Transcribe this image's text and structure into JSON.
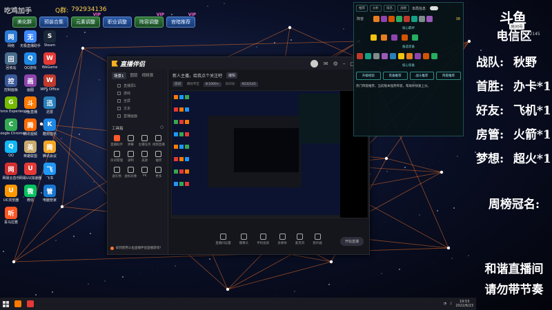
{
  "banner": {
    "logo": "吃鸡加手",
    "qq_label": "Q群:",
    "qq_number": "792934136"
  },
  "groups": [
    {
      "label": "美化群",
      "vip": ""
    },
    {
      "label": "预装合集",
      "vip": ""
    },
    {
      "label": "元素调整",
      "vip": "VIP"
    },
    {
      "label": "职业调整",
      "vip": ""
    },
    {
      "label": "阵容调整",
      "vip": "VIP"
    },
    {
      "label": "官暗推荐",
      "vip": "VIP"
    }
  ],
  "desktop_icons": [
    {
      "label": "网络",
      "color": "#2b7bd6",
      "glyph": "网"
    },
    {
      "label": "无极直播助手",
      "color": "#3d89ff",
      "glyph": "无"
    },
    {
      "label": "Steam",
      "color": "#1b2838",
      "glyph": "S"
    },
    {
      "label": "回收站",
      "color": "#4a6c8c",
      "glyph": "回"
    },
    {
      "label": "QQ游戏",
      "color": "#1e88e5",
      "glyph": "Q"
    },
    {
      "label": "WeGame",
      "color": "#e53935",
      "glyph": "W"
    },
    {
      "label": "控制面板",
      "color": "#3b5998",
      "glyph": "控"
    },
    {
      "label": "画图",
      "color": "#8e44ad",
      "glyph": "画"
    },
    {
      "label": "WPS Office",
      "color": "#c0392b",
      "glyph": "W"
    },
    {
      "label": "GeForce Experience",
      "color": "#76b900",
      "glyph": "G"
    },
    {
      "label": "斗鱼直播",
      "color": "#ff7a00",
      "glyph": "斗"
    },
    {
      "label": "迅雷",
      "color": "#2980b9",
      "glyph": "迅"
    },
    {
      "label": "Google Chrome",
      "color": "#34a853",
      "glyph": "C"
    },
    {
      "label": "腾讯视频",
      "color": "#ff6a00",
      "glyph": "腾"
    },
    {
      "label": "酷狗音乐",
      "color": "#1e88e5",
      "glyph": "K"
    },
    {
      "label": "QQ",
      "color": "#12b7f5",
      "glyph": "Q"
    },
    {
      "label": "英雄联盟",
      "color": "#c8aa6e",
      "glyph": "英"
    },
    {
      "label": "腾讯会议",
      "color": "#f5a623",
      "glyph": "腾"
    },
    {
      "label": "网易云音乐",
      "color": "#d32f2f",
      "glyph": "网"
    },
    {
      "label": "网易UU加速器",
      "color": "#e53935",
      "glyph": "U"
    },
    {
      "label": "飞书",
      "color": "#2196f3",
      "glyph": "飞"
    },
    {
      "label": "UC浏览器",
      "color": "#ff9800",
      "glyph": "U"
    },
    {
      "label": "微信",
      "color": "#07c160",
      "glyph": "微"
    },
    {
      "label": "电脑管家",
      "color": "#1976d2",
      "glyph": "管"
    },
    {
      "label": "喜马拉雅",
      "color": "#ff5722",
      "glyph": "听"
    }
  ],
  "app": {
    "brand": "直播伴侣",
    "scene_tabs": [
      "场景1",
      "图层",
      "视频源"
    ],
    "sources": [
      "直播源1",
      "游戏",
      "全屏",
      "文本",
      "直播画面"
    ],
    "tools_title": "工具箱",
    "tools": [
      "直播助手",
      "弹幕",
      "主播任务",
      "视频直播",
      "房间管理",
      "录制",
      "美颜",
      "抽奖",
      "送礼物",
      "虚拟形象",
      "PK",
      "更多"
    ],
    "tip": "如何使用斗鱼直播伴侣直播游戏？",
    "room_title": "新人主播，给我点个关注吧",
    "room_edit": "编辑",
    "room_meta": [
      "房间",
      "模拟专区",
      "8:1000+",
      "房间号:",
      "9232145"
    ],
    "bottom_tools": [
      "直播间设置",
      "摄像头",
      "手机投屏",
      "多媒体",
      "麦克风",
      "扬声器"
    ],
    "start_label": "开始直播"
  },
  "game_overlay": {
    "tabs": [
      "推荐",
      "分析",
      "排名",
      "战绩"
    ],
    "toggle_label": "本局信息",
    "row_label": "阵容",
    "score": "38",
    "section_titles": [
      "核心羁绊",
      "备选装备",
      "核心装备"
    ],
    "buttons": [
      "升级经验",
      "装备推荐",
      "战斗推荐",
      "阵容推荐"
    ],
    "note": "热门阵容推荐，当前版本强势阵容，帮助你快速上分。"
  },
  "stream_overlay": {
    "platform": "斗鱼",
    "tag": "房间号",
    "room_no": "9232145",
    "title": "电信区",
    "rows": [
      {
        "key": "战队:",
        "value": "秋野"
      },
      {
        "key": "首胜:",
        "value": "办卡*1"
      },
      {
        "key": "好友:",
        "value": "飞机*1"
      },
      {
        "key": "房管:",
        "value": "火箭*1"
      },
      {
        "key": "梦想:",
        "value": "超火*1"
      }
    ],
    "weekly": "周榜冠名:",
    "slogan_1": "和谐直播间",
    "slogan_2": "请勿带节奏"
  },
  "taskbar": {
    "time": "19:53",
    "date": "2022/6/23"
  }
}
